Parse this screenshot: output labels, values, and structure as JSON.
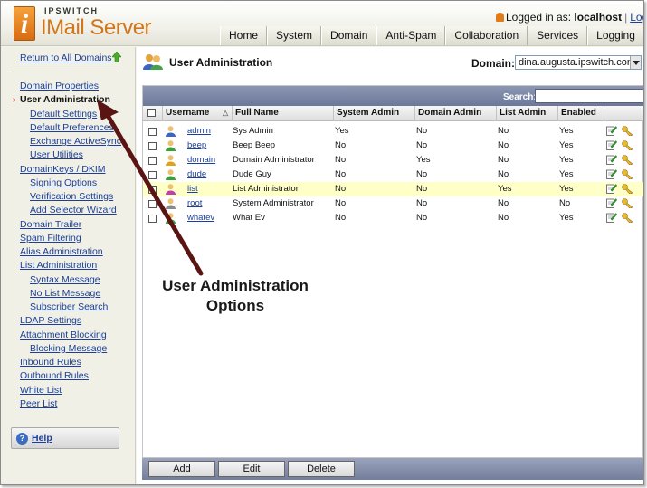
{
  "header": {
    "brand": "IPSWITCH",
    "product": "IMail Server",
    "login_prefix": "Logged in as:",
    "login_user": "localhost",
    "logout_label": "Logout",
    "nav_tabs": [
      {
        "label": "Home"
      },
      {
        "label": "System"
      },
      {
        "label": "Domain"
      },
      {
        "label": "Anti-Spam"
      },
      {
        "label": "Collaboration"
      },
      {
        "label": "Services"
      },
      {
        "label": "Logging"
      }
    ]
  },
  "sidebar": {
    "return_label": "Return to All Domains",
    "items": [
      {
        "label": "Domain Properties",
        "level": 0
      },
      {
        "label": "User Administration",
        "level": 0,
        "active": true
      },
      {
        "label": "Default Settings",
        "level": 1
      },
      {
        "label": "Default Preferences",
        "level": 1
      },
      {
        "label": "Exchange ActiveSync",
        "level": 1
      },
      {
        "label": "User Utilities",
        "level": 1
      },
      {
        "label": "DomainKeys / DKIM",
        "level": 0
      },
      {
        "label": "Signing Options",
        "level": 1
      },
      {
        "label": "Verification Settings",
        "level": 1
      },
      {
        "label": "Add Selector Wizard",
        "level": 1
      },
      {
        "label": "Domain Trailer",
        "level": 0
      },
      {
        "label": "Spam Filtering",
        "level": 0
      },
      {
        "label": "Alias Administration",
        "level": 0
      },
      {
        "label": "List Administration",
        "level": 0
      },
      {
        "label": "Syntax Message",
        "level": 1
      },
      {
        "label": "No List Message",
        "level": 1
      },
      {
        "label": "Subscriber Search",
        "level": 1
      },
      {
        "label": "LDAP Settings",
        "level": 0
      },
      {
        "label": "Attachment Blocking",
        "level": 0
      },
      {
        "label": "Blocking Message",
        "level": 1
      },
      {
        "label": "Inbound Rules",
        "level": 0
      },
      {
        "label": "Outbound Rules",
        "level": 0
      },
      {
        "label": "White List",
        "level": 0
      },
      {
        "label": "Peer List",
        "level": 0
      }
    ],
    "help_label": "Help"
  },
  "main": {
    "title": "User Administration",
    "domain_label": "Domain:",
    "domain_value": "dina.augusta.ipswitch.com",
    "search_label": "Search:",
    "search_value": "",
    "columns": [
      "Username",
      "Full Name",
      "System Admin",
      "Domain Admin",
      "List Admin",
      "Enabled"
    ],
    "users": [
      {
        "username": "admin",
        "full_name": "Sys Admin",
        "system_admin": "Yes",
        "domain_admin": "No",
        "list_admin": "No",
        "enabled": "Yes",
        "icon_color": "#3a64c8",
        "highlight": false
      },
      {
        "username": "beep",
        "full_name": "Beep Beep",
        "system_admin": "No",
        "domain_admin": "No",
        "list_admin": "No",
        "enabled": "Yes",
        "icon_color": "#3aa03a",
        "highlight": false
      },
      {
        "username": "domain",
        "full_name": "Domain Administrator",
        "system_admin": "No",
        "domain_admin": "Yes",
        "list_admin": "No",
        "enabled": "Yes",
        "icon_color": "#e0a21a",
        "highlight": false
      },
      {
        "username": "dude",
        "full_name": "Dude Guy",
        "system_admin": "No",
        "domain_admin": "No",
        "list_admin": "No",
        "enabled": "Yes",
        "icon_color": "#3aa03a",
        "highlight": false
      },
      {
        "username": "list",
        "full_name": "List Administrator",
        "system_admin": "No",
        "domain_admin": "No",
        "list_admin": "Yes",
        "enabled": "Yes",
        "icon_color": "#c040b0",
        "highlight": true
      },
      {
        "username": "root",
        "full_name": "System Administrator",
        "system_admin": "No",
        "domain_admin": "No",
        "list_admin": "No",
        "enabled": "No",
        "icon_color": "#8a8a8a",
        "highlight": false
      },
      {
        "username": "whatev",
        "full_name": "What Ev",
        "system_admin": "No",
        "domain_admin": "No",
        "list_admin": "No",
        "enabled": "Yes",
        "icon_color": "#3aa03a",
        "highlight": false
      }
    ],
    "buttons": {
      "add": "Add",
      "edit": "Edit",
      "delete": "Delete"
    }
  },
  "annotation": {
    "line1": "User Administration",
    "line2": "Options",
    "arrow_color": "#5a1414"
  }
}
